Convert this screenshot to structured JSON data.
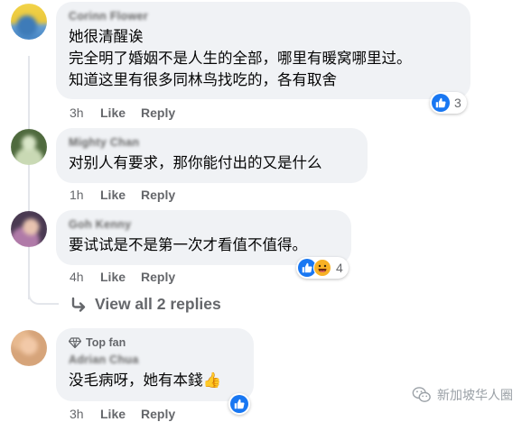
{
  "comments": [
    {
      "author": "Corinn Flower",
      "lines": [
        "她很清醒诶",
        "完全明了婚姻不是人生的全部，哪里有暖窝哪里过。",
        "知道这里有很多同林鸟找吃的，各有取舍"
      ],
      "time": "3h",
      "like_label": "Like",
      "reply_label": "Reply",
      "reaction_count": "3"
    },
    {
      "author": "Mighty Chan",
      "lines": [
        "对别人有要求，那你能付出的又是什么"
      ],
      "time": "1h",
      "like_label": "Like",
      "reply_label": "Reply"
    },
    {
      "author": "Goh Kenny",
      "lines": [
        "要试试是不是第一次才看值不值得。"
      ],
      "time": "4h",
      "like_label": "Like",
      "reply_label": "Reply",
      "reaction_count": "4"
    },
    {
      "badge": "Top fan",
      "author": "Adrian Chua",
      "lines": [
        "没毛病呀，她有本錢👍"
      ],
      "time": "3h",
      "like_label": "Like",
      "reply_label": "Reply"
    }
  ],
  "view_replies": "View all 2 replies",
  "watermark": "新加坡华人圈",
  "colors": {
    "bubble": "#f0f2f5",
    "secondary_text": "#65676b",
    "like_blue": "#1877f2",
    "haha_yellow": "#f7b125"
  }
}
